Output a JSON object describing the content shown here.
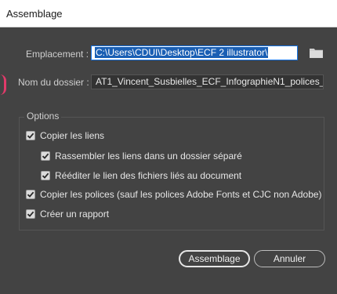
{
  "dialog": {
    "title": "Assemblage"
  },
  "location": {
    "label": "Emplacement :",
    "value": "C:\\Users\\CDUI\\Desktop\\ECF 2 illustrator\\"
  },
  "folder_name": {
    "label": "Nom du dossier :",
    "value": "AT1_Vincent_Susbielles_ECF_InfographieN1_polices_"
  },
  "options": {
    "title": "Options",
    "copy_links": {
      "label": "Copier les liens",
      "checked": true
    },
    "gather_links": {
      "label": "Rassembler les liens dans un dossier séparé",
      "checked": true
    },
    "relink": {
      "label": "Rééditer le lien des fichiers liés au document",
      "checked": true
    },
    "copy_fonts": {
      "label": "Copier les polices (sauf les polices Adobe Fonts et CJC non Adobe)",
      "checked": true
    },
    "report": {
      "label": "Créer un rapport",
      "checked": true
    }
  },
  "buttons": {
    "package": "Assemblage",
    "cancel": "Annuler"
  },
  "icons": {
    "folder": "folder-icon",
    "checkmark": "checkmark-icon"
  },
  "colors": {
    "dialog_bg": "#434343",
    "field_bg": "#333333",
    "selection": "#1a5fb4",
    "focus_border": "#1473e6"
  }
}
